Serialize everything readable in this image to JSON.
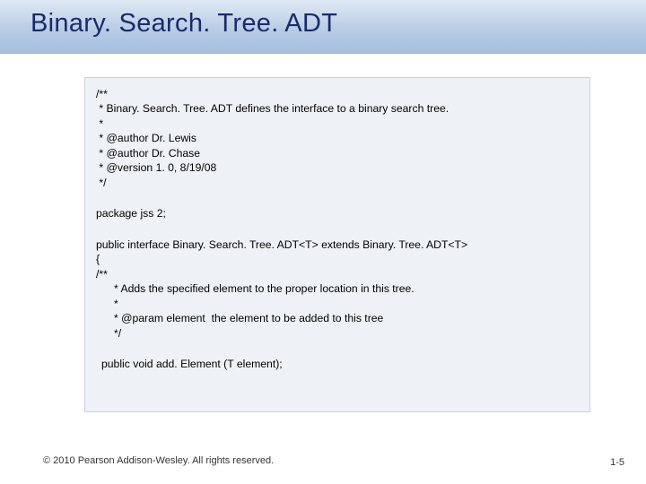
{
  "title": "Binary. Search. Tree. ADT",
  "code": {
    "javadoc1": "/**\n * Binary. Search. Tree. ADT defines the interface to a binary search tree.\n *\n * @author Dr. Lewis\n * @author Dr. Chase\n * @version 1. 0, 8/19/08\n */",
    "package": "package jss 2;",
    "interface": "public interface Binary. Search. Tree. ADT<T> extends Binary. Tree. ADT<T>\n{\n/**",
    "javadoc2": "* Adds the specified element to the proper location in this tree.\n*\n* @param element  the element to be added to this tree\n*/",
    "method": "public void add. Element (T element);"
  },
  "footer": {
    "copyright": "© 2010 Pearson Addison-Wesley. All rights reserved.",
    "page": "1-5"
  }
}
